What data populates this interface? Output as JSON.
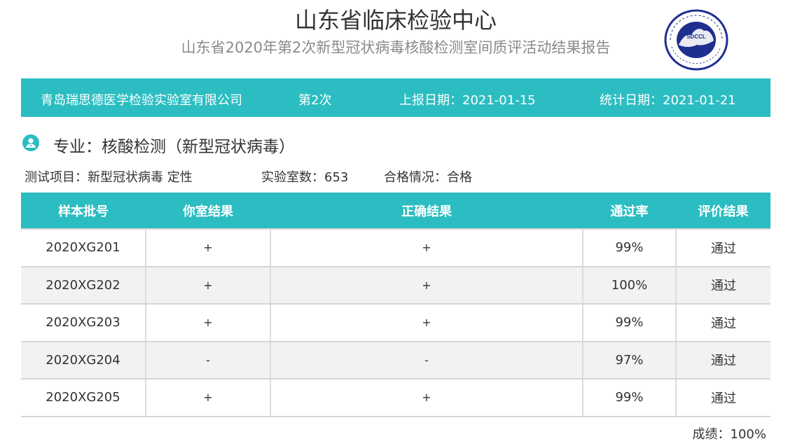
{
  "header": {
    "title": "山东省临床检验中心",
    "subtitle": "山东省2020年第2次新型冠状病毒核酸检测室间质评活动结果报告",
    "logo": {
      "center_text": "SDCCL",
      "top_text": "山东省临床检验中心",
      "bottom_text": "Shan Dong Center For Clinical Laboratory",
      "color": "#1f2f8f"
    }
  },
  "info_bar": {
    "lab_name": "青岛瑞思德医学检验实验室有限公司",
    "round": "第2次",
    "report_date": "上报日期：2021-01-15",
    "stat_date": "统计日期：2021-01-21",
    "color": "#2bbdc1"
  },
  "section": {
    "icon": "doctor-badge-icon",
    "title": "专业：核酸检测（新型冠状病毒）"
  },
  "meta": {
    "test_item": "测试项目：新型冠状病毒 定性",
    "lab_count": "实验室数：653",
    "status": "合格情况：合格"
  },
  "table": {
    "headers": [
      "样本批号",
      "你室结果",
      "正确结果",
      "通过率",
      "评价结果"
    ],
    "rows": [
      [
        "2020XG201",
        "+",
        "+",
        "99%",
        "通过"
      ],
      [
        "2020XG202",
        "+",
        "+",
        "100%",
        "通过"
      ],
      [
        "2020XG203",
        "+",
        "+",
        "99%",
        "通过"
      ],
      [
        "2020XG204",
        "-",
        "-",
        "97%",
        "通过"
      ],
      [
        "2020XG205",
        "+",
        "+",
        "99%",
        "通过"
      ]
    ]
  },
  "score": "成绩：100%"
}
